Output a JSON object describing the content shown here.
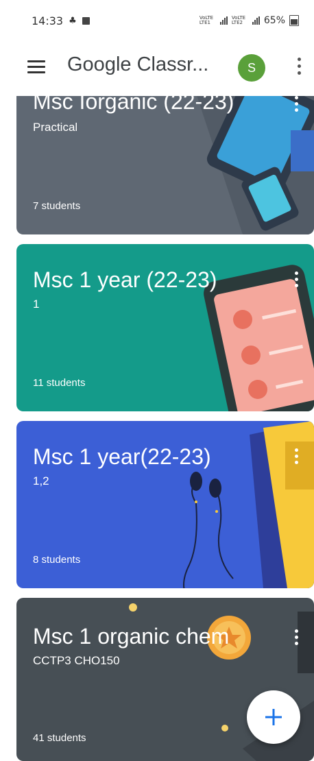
{
  "status_bar": {
    "time": "14:33",
    "network_label_1": "VoLTE LTE1",
    "network_label_2": "VoLTE LTE2",
    "battery": "65%"
  },
  "app_bar": {
    "title": "Google Classr...",
    "avatar_letter": "S"
  },
  "classes": [
    {
      "title": "Msc Iorganic (22-23)",
      "section": "Practical",
      "students": "7 students",
      "color": "#5f6873"
    },
    {
      "title": "Msc 1 year (22-23)",
      "section": "1",
      "students": "11 students",
      "color": "#149b8a"
    },
    {
      "title": "Msc 1 year(22-23)",
      "section": "1,2",
      "students": "8 students",
      "color": "#3c5fd6"
    },
    {
      "title": "Msc 1 organic chem",
      "section": "CCTP3 CHO150",
      "students": "41 students",
      "color": "#474f55"
    }
  ],
  "fab": {
    "icon": "plus-icon",
    "color": "#1a73e8"
  }
}
